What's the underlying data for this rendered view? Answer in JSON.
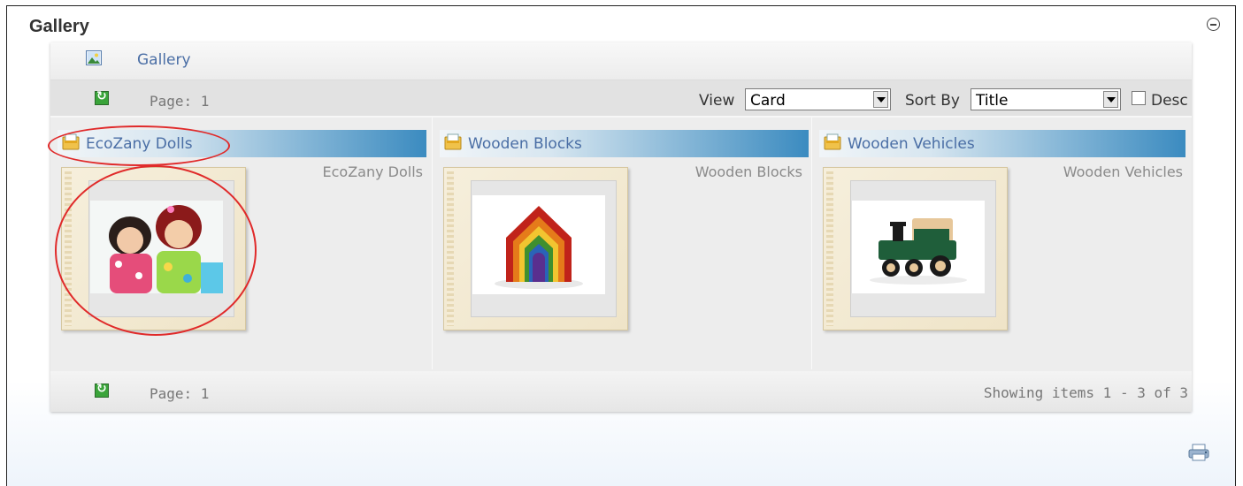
{
  "module": {
    "title": "Gallery"
  },
  "breadcrumb": {
    "label": "Gallery"
  },
  "toolbar": {
    "page_label": "Page: 1",
    "view_label": "View",
    "view_value": "Card",
    "sort_label": "Sort By",
    "sort_value": "Title",
    "desc_label": "Desc"
  },
  "albums": [
    {
      "title": "EcoZany Dolls",
      "description": "EcoZany Dolls"
    },
    {
      "title": "Wooden Blocks",
      "description": "Wooden Blocks"
    },
    {
      "title": "Wooden Vehicles",
      "description": "Wooden Vehicles"
    }
  ],
  "footer": {
    "page_label": "Page: 1",
    "showing": "Showing items 1 - 3 of 3"
  },
  "colors": {
    "link": "#4a6ea5",
    "annotation": "#e02a2a",
    "header_accent": "#3b8bc0"
  },
  "icons": [
    "collapse-icon",
    "gallery-image-icon",
    "refresh-icon",
    "folder-icon",
    "print-icon"
  ]
}
